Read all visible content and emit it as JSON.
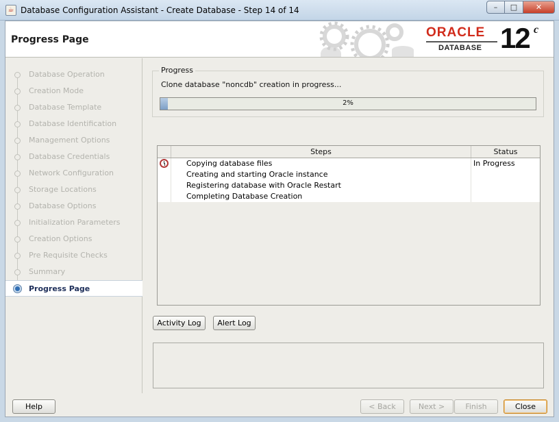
{
  "window": {
    "title": "Database Configuration Assistant - Create Database - Step 14 of 14",
    "icon": "java-cup-icon",
    "controls": [
      "minimize-icon",
      "maximize-icon",
      "close-icon"
    ]
  },
  "header": {
    "page_title": "Progress Page",
    "logo": {
      "oracle": "ORACLE",
      "product": "DATABASE",
      "version": "12",
      "version_sup": "c"
    },
    "accent_color": "#d12b1b"
  },
  "sidebar": {
    "items": [
      {
        "label": "Database Operation",
        "state": "done"
      },
      {
        "label": "Creation Mode",
        "state": "done"
      },
      {
        "label": "Database Template",
        "state": "done"
      },
      {
        "label": "Database Identification",
        "state": "done"
      },
      {
        "label": "Management Options",
        "state": "done"
      },
      {
        "label": "Database Credentials",
        "state": "done"
      },
      {
        "label": "Network Configuration",
        "state": "done"
      },
      {
        "label": "Storage Locations",
        "state": "done"
      },
      {
        "label": "Database Options",
        "state": "done"
      },
      {
        "label": "Initialization Parameters",
        "state": "done"
      },
      {
        "label": "Creation Options",
        "state": "done"
      },
      {
        "label": "Pre Requisite Checks",
        "state": "done"
      },
      {
        "label": "Summary",
        "state": "done"
      },
      {
        "label": "Progress Page",
        "state": "active"
      }
    ]
  },
  "progress": {
    "group_label": "Progress",
    "message": "Clone database \"noncdb\" creation in progress...",
    "percent_text": "2%",
    "fraction": 0.02
  },
  "steps_table": {
    "headers": [
      "Steps",
      "Status"
    ],
    "rows": [
      {
        "step": "Copying database files",
        "status": "In Progress",
        "icon": "clock-icon"
      },
      {
        "step": "Creating and starting Oracle instance",
        "status": "",
        "icon": ""
      },
      {
        "step": "Registering database with Oracle Restart",
        "status": "",
        "icon": ""
      },
      {
        "step": "Completing Database Creation",
        "status": "",
        "icon": ""
      }
    ]
  },
  "buttons": {
    "activity_log": "Activity Log",
    "alert_log": "Alert Log",
    "help": "Help",
    "back": "< Back",
    "next": "Next >",
    "finish": "Finish",
    "close": "Close"
  }
}
